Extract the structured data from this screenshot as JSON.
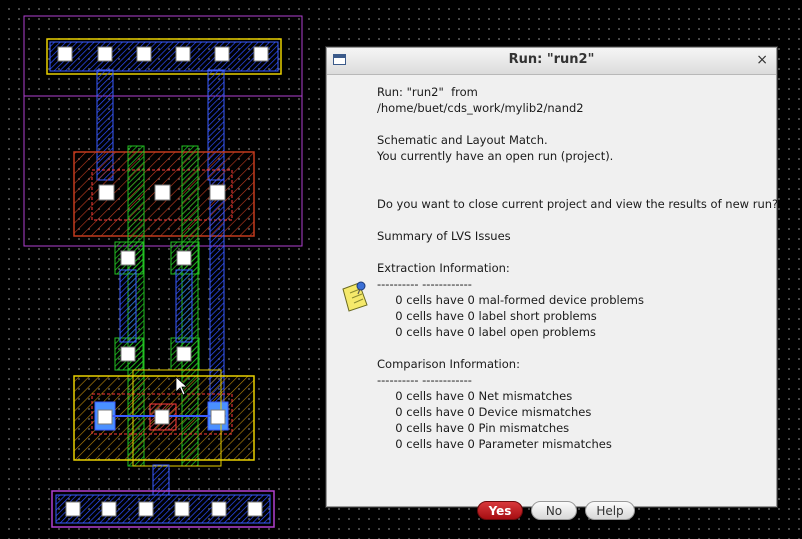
{
  "dialog": {
    "title": "Run: \"run2\"",
    "close_glyph": "×",
    "icon": "note-pin-icon",
    "message_lines": [
      "Run: \"run2\"  from",
      "/home/buet/cds_work/mylib2/nand2",
      "",
      "Schematic and Layout Match.",
      "You currently have an open run (project).",
      "",
      "",
      "Do you want to close current project and view the results of new run?",
      "",
      "Summary of LVS Issues",
      "",
      "Extraction Information:",
      "---------- ------------",
      "     0 cells have 0 mal-formed device problems",
      "     0 cells have 0 label short problems",
      "     0 cells have 0 label open problems",
      "",
      "Comparison Information:",
      "---------- ------------",
      "     0 cells have 0 Net mismatches",
      "     0 cells have 0 Device mismatches",
      "     0 cells have 0 Pin mismatches",
      "     0 cells have 0 Parameter mismatches"
    ],
    "buttons": {
      "yes": "Yes",
      "no": "No",
      "help": "Help"
    }
  },
  "colors": {
    "accent_button": "#b01217",
    "layout_background": "#000000",
    "metal1": "#3a5cff",
    "poly": "#ff3a3a",
    "diffusion": "#ffd700",
    "nwell": "#b040d0",
    "contact": "#ffffff",
    "via_green": "#22c022"
  }
}
